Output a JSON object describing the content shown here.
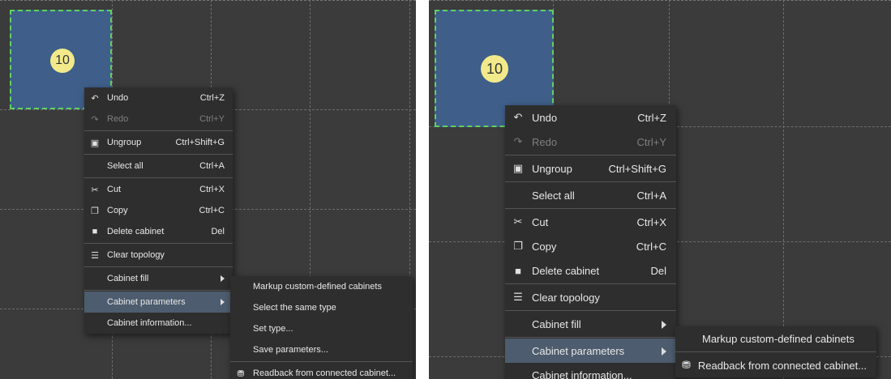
{
  "cabinet": {
    "number": "10"
  },
  "context_menu": {
    "undo": {
      "icon": "undo-icon",
      "label": "Undo",
      "shortcut": "Ctrl+Z"
    },
    "redo": {
      "icon": "redo-icon",
      "label": "Redo",
      "shortcut": "Ctrl+Y"
    },
    "ungroup": {
      "icon": "ungroup-icon",
      "label": "Ungroup",
      "shortcut": "Ctrl+Shift+G"
    },
    "select_all": {
      "label": "Select all",
      "shortcut": "Ctrl+A"
    },
    "cut": {
      "icon": "cut-icon",
      "label": "Cut",
      "shortcut": "Ctrl+X"
    },
    "copy": {
      "icon": "copy-icon",
      "label": "Copy",
      "shortcut": "Ctrl+C"
    },
    "delete_cabinet": {
      "icon": "trash-icon",
      "label": "Delete cabinet",
      "shortcut": "Del"
    },
    "clear_topology": {
      "icon": "topology-icon",
      "label": "Clear topology"
    },
    "cabinet_fill": {
      "label": "Cabinet fill"
    },
    "cabinet_parameters": {
      "label": "Cabinet parameters"
    },
    "cabinet_information": {
      "label": "Cabinet information..."
    }
  },
  "left_submenu": {
    "markup": "Markup custom-defined cabinets",
    "select_same_type": "Select the same type",
    "set_type": "Set type...",
    "save_parameters": "Save parameters...",
    "readback": "Readback from connected cabinet..."
  },
  "right_submenu": {
    "markup": "Markup custom-defined cabinets",
    "readback": "Readback from connected cabinet..."
  },
  "colors": {
    "canvas": "#3b3b3b",
    "menu_bg": "#2e2e2e",
    "highlight": "#4d5c6e",
    "cabinet_fill": "#3f5f8a",
    "cabinet_border": "#5fd25f",
    "badge": "#f2ea8a"
  }
}
